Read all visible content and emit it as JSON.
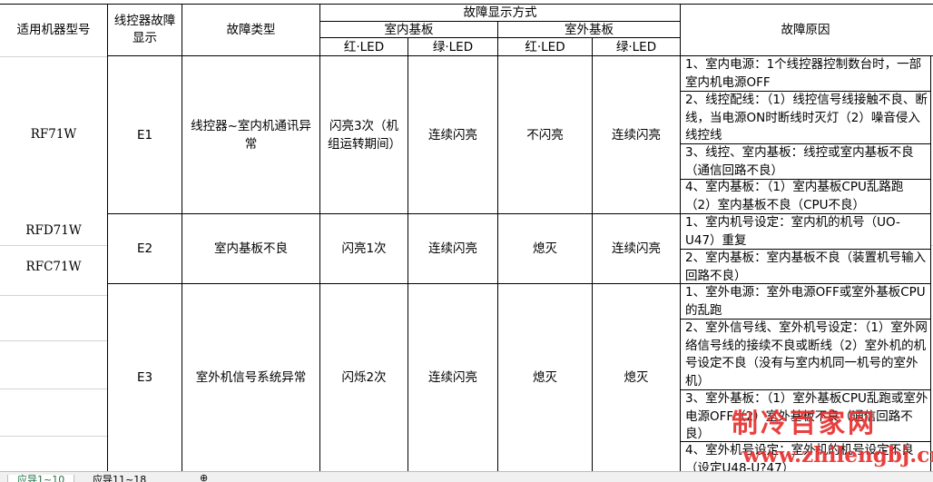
{
  "header": {
    "model": "适用机器型号",
    "display": "线控器故障\n显示",
    "fault_type": "故障类型",
    "mode": "故障显示方式",
    "indoor_board": "室内基板",
    "outdoor_board": "室外基板",
    "red_led": "红·LED",
    "green_led": "绿·LED",
    "red_led2": "红·LED",
    "green_led2": "绿·LED",
    "cause": "故障原因"
  },
  "models": [
    "RF71W",
    "RFD71W",
    "RFC71W"
  ],
  "rows": [
    {
      "code": "E1",
      "type": "线控器~室内机通讯异常",
      "indoor_red": "闪亮3次（机组运转期间）",
      "indoor_green": "连续闪亮",
      "outdoor_red": "不闪亮",
      "outdoor_green": "连续闪亮",
      "causes": [
        "1、室内电源：1个线控器控制数台时，一部室内机电源OFF",
        "2、线控配线：（1）线控信号线接触不良、断线，当电源ON时断线时灭灯（2）噪音侵入线控线",
        "3、线控、室内基板：线控或室内基板不良（通信回路不良）",
        "4、室内基板：（1）室内基板CPU乱路跑（2）室内基板不良（CPU不良）"
      ]
    },
    {
      "code": "E2",
      "type": "室内基板不良",
      "indoor_red": "闪亮1次",
      "indoor_green": "连续闪亮",
      "outdoor_red": "熄灭",
      "outdoor_green": "连续闪亮",
      "causes": [
        "1、室内机号设定：室内机的机号（UO-U47）重复",
        "2、室内基板：室内基板不良（装置机号输入回路不良）"
      ]
    },
    {
      "code": "E3",
      "type": "室外机信号系统异常",
      "indoor_red": "闪烁2次",
      "indoor_green": "连续闪亮",
      "outdoor_red": "熄灭",
      "outdoor_green": "熄灭",
      "causes": [
        "1、室外电源：室外电源OFF或室外基板CPU的乱跑",
        "2、室外信号线、室外机号设定：（1）室外网络信号线的接续不良或断线（2）室外机的机号设定不良（没有与室内机同一机号的室外机）",
        "3、室外基板：（1）室外基板CPU乱跑或室外电源OFF（2）室外基板不良（通信回路不良）",
        "4、室外机号设定：室外机的机号设定不良（设定U48-U?47）"
      ]
    }
  ],
  "watermark": {
    "line1": "制冷百家网",
    "line2": "www.zhilengbj.cn",
    "color": "#e8302f"
  },
  "sheet_tabs": [
    "应导1~10",
    "应导11~18"
  ]
}
